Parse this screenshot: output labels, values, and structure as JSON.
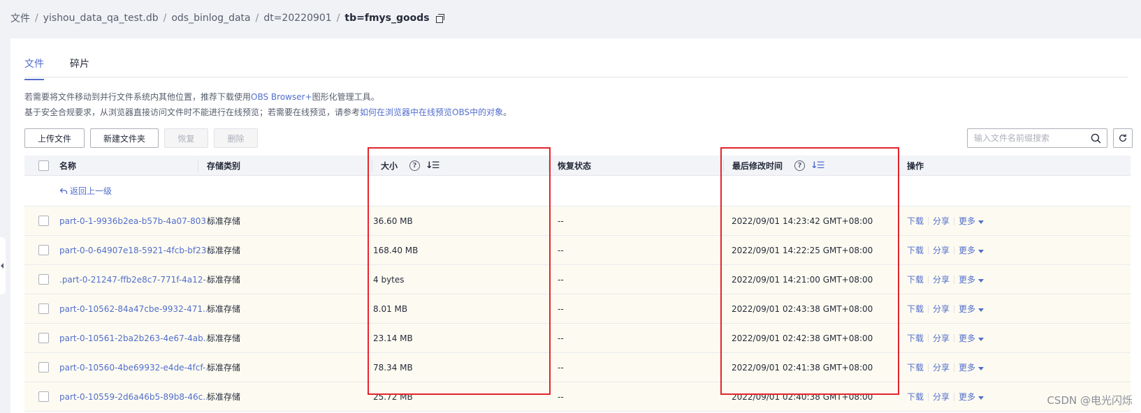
{
  "breadcrumb": {
    "items": [
      "文件",
      "yishou_data_qa_test.db",
      "ods_binlog_data",
      "dt=20220901"
    ],
    "current": "tb=fmys_goods",
    "separator": "/"
  },
  "tabs": [
    {
      "label": "文件",
      "active": true
    },
    {
      "label": "碎片",
      "active": false
    }
  ],
  "notices": {
    "line1_prefix": "若需要将文件移动到并行文件系统内其他位置，推荐下载使用",
    "line1_link": "OBS Browser+",
    "line1_suffix": "图形化管理工具。",
    "line2_prefix": "基于安全合规要求，从浏览器直接访问文件时不能进行在线预览；若需要在线预览，请参考",
    "line2_link": "如何在浏览器中在线预览OBS中的对象",
    "line2_suffix": "。"
  },
  "toolbar": {
    "upload_label": "上传文件",
    "new_folder_label": "新建文件夹",
    "restore_label": "恢复",
    "delete_label": "删除"
  },
  "search": {
    "placeholder": "输入文件名前缀搜索",
    "value": ""
  },
  "table": {
    "headers": {
      "name": "名称",
      "storage": "存储类别",
      "size": "大小",
      "restore_status": "恢复状态",
      "modified": "最后修改时间",
      "actions": "操作"
    },
    "back_label": "返回上一级",
    "rows": [
      {
        "name": "part-0-1-9936b2ea-b57b-4a07-803...",
        "storage": "标准存储",
        "size": "36.60 MB",
        "restore": "--",
        "modified": "2022/09/01 14:23:42 GMT+08:00"
      },
      {
        "name": "part-0-0-64907e18-5921-4fcb-bf23...",
        "storage": "标准存储",
        "size": "168.40 MB",
        "restore": "--",
        "modified": "2022/09/01 14:22:25 GMT+08:00"
      },
      {
        "name": ".part-0-21247-ffb2e8c7-771f-4a12-...",
        "storage": "标准存储",
        "size": "4 bytes",
        "restore": "--",
        "modified": "2022/09/01 14:21:00 GMT+08:00"
      },
      {
        "name": "part-0-10562-84a47cbe-9932-471...",
        "storage": "标准存储",
        "size": "8.01 MB",
        "restore": "--",
        "modified": "2022/09/01 02:43:38 GMT+08:00"
      },
      {
        "name": "part-0-10561-2ba2b263-4e67-4ab...",
        "storage": "标准存储",
        "size": "23.14 MB",
        "restore": "--",
        "modified": "2022/09/01 02:42:38 GMT+08:00"
      },
      {
        "name": "part-0-10560-4be69932-e4de-4fcf-...",
        "storage": "标准存储",
        "size": "78.34 MB",
        "restore": "--",
        "modified": "2022/09/01 02:41:38 GMT+08:00"
      },
      {
        "name": "part-0-10559-2d6a46b5-89b8-46c...",
        "storage": "标准存储",
        "size": "25.72 MB",
        "restore": "--",
        "modified": "2022/09/01 02:40:38 GMT+08:00"
      }
    ],
    "row_actions": {
      "download": "下载",
      "share": "分享",
      "more": "更多"
    }
  },
  "watermark": "CSDN @电光闪烁",
  "colors": {
    "accent": "#526ecc",
    "highlight_border": "#e3242b",
    "row_highlight_bg": "#fdfbf1",
    "header_bg": "#f3f4f8"
  }
}
